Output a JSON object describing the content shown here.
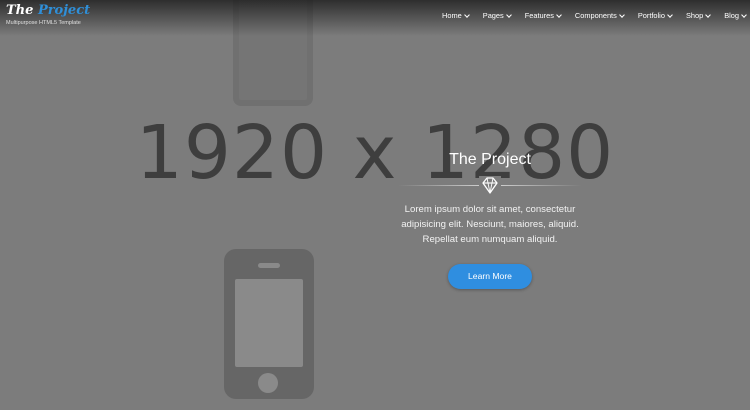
{
  "brand": {
    "name_part1": "The ",
    "name_part2": "Project",
    "tagline": "Multipurpose HTML5 Template",
    "accent_color": "#2f8fd8"
  },
  "nav": {
    "items": [
      {
        "label": "Home"
      },
      {
        "label": "Pages"
      },
      {
        "label": "Features"
      },
      {
        "label": "Components"
      },
      {
        "label": "Portfolio"
      },
      {
        "label": "Shop"
      },
      {
        "label": "Blog"
      }
    ]
  },
  "placeholder": {
    "dimensions": "1920 x 1280"
  },
  "hero": {
    "title": "The Project",
    "divider_icon": "diamond-icon",
    "text": "Lorem ipsum dolor sit amet, consectetur\nadipisicing elit. Nesciunt, maiores, aliquid.\nRepellat eum numquam aliquid.",
    "cta_label": "Learn More",
    "cta_color": "#2f8ee0"
  }
}
